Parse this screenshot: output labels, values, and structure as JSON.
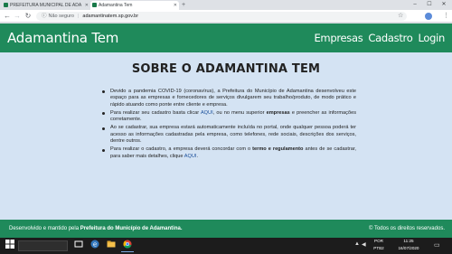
{
  "browser": {
    "tabs": [
      {
        "title": "PREFEITURA MUNICIPAL DE ADA"
      },
      {
        "title": "Adamantina Tem"
      }
    ],
    "new_tab_symbol": "+",
    "window_controls": {
      "minimize": "–",
      "maximize": "☐",
      "close": "✕"
    },
    "nav": {
      "back": "←",
      "forward": "→",
      "reload": "↻"
    },
    "address": {
      "info_symbol": "ⓘ",
      "security_label": "Não seguro",
      "url": "adamantinatem.sp.gov.br"
    },
    "toolbar_icons": {
      "star": "☆",
      "menu": "⋮"
    }
  },
  "site": {
    "brand": "Adamantina Tem",
    "nav": [
      "Empresas",
      "Cadastro",
      "Login"
    ]
  },
  "main": {
    "title": "SOBRE O ADAMANTINA TEM",
    "bullets": [
      {
        "parts": [
          {
            "text": "Devido a pandemia COVID-19 (coronavírus), a Prefeitura do Município de Adamantina desenvolveu este espaço para as empresas e fornecedores de serviços divulgarem seu trabalho/produto, de modo prático e rápido atuando como ponte entre cliente e empresa."
          }
        ]
      },
      {
        "parts": [
          {
            "text": "Para realizar seu cadastro basta clicar "
          },
          {
            "text": "AQUI",
            "link": true
          },
          {
            "text": ", ou no menu superior "
          },
          {
            "text": "empresas",
            "bold": true
          },
          {
            "text": " e preencher as informações corretamente."
          }
        ]
      },
      {
        "parts": [
          {
            "text": "Ao se cadastrar, sua empresa estará automaticamente incluída no portal, onde qualquer pessoa poderá ter acesso as informações cadastradas pela empresa, como telefones, rede sociais, descrições dos serviços, dentre outros."
          }
        ]
      },
      {
        "parts": [
          {
            "text": "Para realizar o cadastro, a empresa deverá concordar com o "
          },
          {
            "text": "termo e regulamento",
            "bold": true
          },
          {
            "text": " antes de se cadastrar, para saber mais detalhes, clique "
          },
          {
            "text": "AQUI",
            "link": true
          },
          {
            "text": "."
          }
        ]
      }
    ]
  },
  "footer": {
    "prefix": "Desenvolvido e mantido pela ",
    "org": "Prefeitura do Município de Adamantina.",
    "rights": "© Todos os direitos reservados."
  },
  "taskbar": {
    "icons": [
      "windows-start-icon",
      "search-box",
      "task-view-icon",
      "edge-icon",
      "file-explorer-icon",
      "chrome-icon"
    ],
    "tray": {
      "lang": "POR",
      "layout": "PTB2",
      "time": "11:25",
      "date": "16/07/2020"
    }
  },
  "colors": {
    "brand_green": "#1f8a5b",
    "content_bg": "#d4e3f3",
    "link_blue": "#1a4f9b"
  }
}
